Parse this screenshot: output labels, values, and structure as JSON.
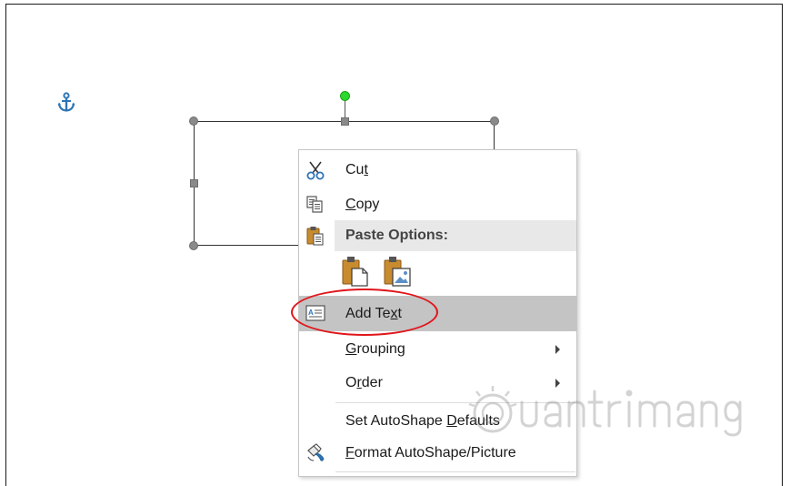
{
  "context_menu": {
    "items": [
      {
        "id": "cut",
        "label_pre": "Cu",
        "label_u": "t",
        "label_post": "",
        "icon": "scissors-icon"
      },
      {
        "id": "copy",
        "label_pre": "",
        "label_u": "C",
        "label_post": "opy",
        "icon": "copy-icon"
      },
      {
        "id": "paste_options",
        "label": "Paste Options:",
        "icon": "paste-icon"
      },
      {
        "id": "add_text",
        "label_pre": "Add Te",
        "label_u": "x",
        "label_post": "t",
        "icon": "text-box-icon",
        "highlighted": true
      },
      {
        "id": "grouping",
        "label_pre": "",
        "label_u": "G",
        "label_post": "rouping",
        "has_submenu": true
      },
      {
        "id": "order",
        "label_pre": "O",
        "label_u": "r",
        "label_post": "der",
        "has_submenu": true
      },
      {
        "id": "set_autoshape_defaults",
        "label_pre": "Set AutoShape ",
        "label_u": "D",
        "label_post": "efaults"
      },
      {
        "id": "format_autoshape",
        "label_pre": "",
        "label_u": "F",
        "label_post": "ormat AutoShape/Picture",
        "icon": "format-brush-icon"
      }
    ],
    "paste_buttons": [
      {
        "id": "keep_source",
        "icon": "paste-keep-formatting-icon"
      },
      {
        "id": "picture",
        "icon": "paste-picture-icon"
      }
    ]
  },
  "canvas": {
    "anchor_icon": "anchor-icon"
  },
  "colors": {
    "highlight": "#c4c4c4",
    "annotation_red": "#e0161b",
    "rotate_handle": "#2bd82b",
    "anchor": "#2e75b6"
  }
}
